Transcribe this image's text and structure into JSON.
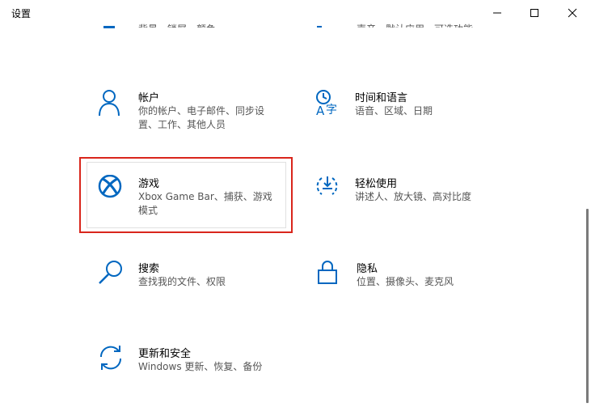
{
  "window": {
    "title": "设置"
  },
  "top_partial": {
    "left_desc": "背景、锁屏、颜色",
    "right_desc": "声音、默认应用、可选功能"
  },
  "tiles": [
    {
      "name": "帐户",
      "desc": "你的帐户、电子邮件、同步设置、工作、其他人员",
      "icon": "person-icon"
    },
    {
      "name": "时间和语言",
      "desc": "语音、区域、日期",
      "icon": "time-language-icon"
    },
    {
      "name": "游戏",
      "desc": "Xbox Game Bar、捕获、游戏模式",
      "icon": "xbox-icon"
    },
    {
      "name": "轻松使用",
      "desc": "讲述人、放大镜、高对比度",
      "icon": "ease-of-access-icon"
    },
    {
      "name": "搜索",
      "desc": "查找我的文件、权限",
      "icon": "search-icon"
    },
    {
      "name": "隐私",
      "desc": "位置、摄像头、麦克风",
      "icon": "lock-icon"
    },
    {
      "name": "更新和安全",
      "desc": "Windows 更新、恢复、备份",
      "icon": "sync-icon"
    }
  ],
  "colors": {
    "accent": "#0067c0",
    "highlight": "#d9261c"
  }
}
